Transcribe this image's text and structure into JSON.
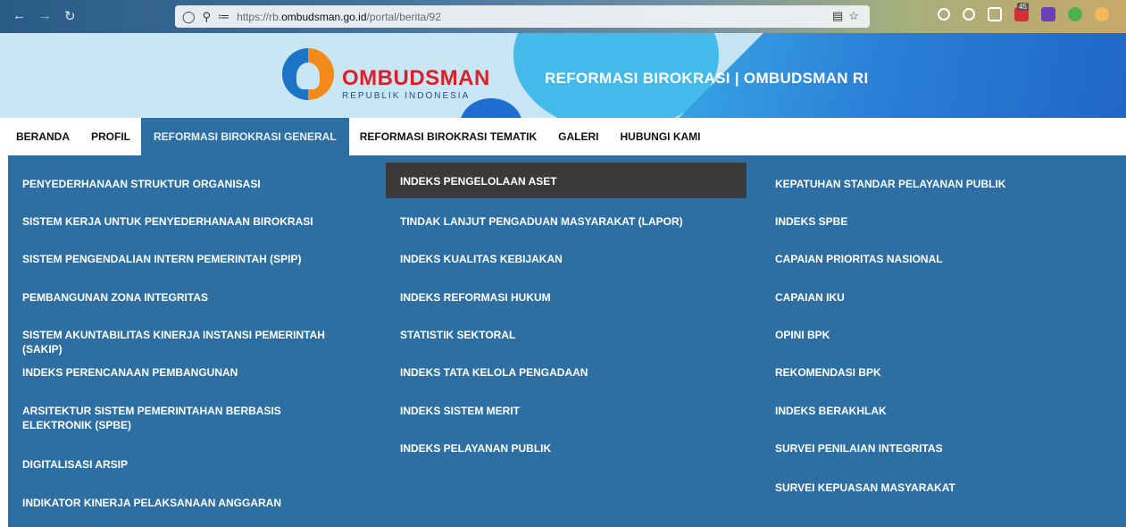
{
  "browser": {
    "back_icon": "arrow-left-icon",
    "forward_icon": "arrow-right-icon",
    "reload_icon": "reload-icon",
    "url_prefix": "https://rb.",
    "url_host": "ombudsman.go.id",
    "url_path": "/portal/berita/92",
    "extension_badge": "45"
  },
  "header": {
    "logo_title": "OMBUDSMAN",
    "logo_subtitle": "REPUBLIK INDONESIA",
    "site_title": "REFORMASI BIROKRASI | OMBUDSMAN RI"
  },
  "nav": {
    "items": [
      {
        "label": "BERANDA"
      },
      {
        "label": "PROFIL"
      },
      {
        "label": "REFORMASI BIROKRASI GENERAL"
      },
      {
        "label": "REFORMASI BIROKRASI TEMATIK"
      },
      {
        "label": "GALERI"
      },
      {
        "label": "HUBUNGI KAMI"
      }
    ],
    "active_index": 2
  },
  "menu": {
    "col1": [
      "PENYEDERHANAAN STRUKTUR ORGANISASI",
      "SISTEM KERJA UNTUK PENYEDERHANAAN BIROKRASI",
      "SISTEM PENGENDALIAN INTERN PEMERINTAH (SPIP)",
      "PEMBANGUNAN ZONA INTEGRITAS",
      "SISTEM AKUNTABILITAS KINERJA INSTANSI PEMERINTAH (SAKIP)",
      "INDEKS PERENCANAAN PEMBANGUNAN",
      "ARSITEKTUR SISTEM PEMERINTAHAN BERBASIS ELEKTRONIK (SPBE)",
      "DIGITALISASI ARSIP",
      "INDIKATOR KINERJA PELAKSANAAN ANGGARAN"
    ],
    "col2": [
      "INDEKS PENGELOLAAN ASET",
      "TINDAK LANJUT PENGADUAN MASYARAKAT (LAPOR)",
      "INDEKS KUALITAS KEBIJAKAN",
      "INDEKS REFORMASI HUKUM",
      "STATISTIK SEKTORAL",
      "INDEKS TATA KELOLA PENGADAAN",
      "INDEKS SISTEM MERIT",
      "INDEKS PELAYANAN PUBLIK"
    ],
    "col3": [
      "KEPATUHAN STANDAR PELAYANAN PUBLIK",
      "INDEKS SPBE",
      "CAPAIAN PRIORITAS NASIONAL",
      "CAPAIAN IKU",
      "OPINI BPK",
      "REKOMENDASI BPK",
      "INDEKS BERAKHLAK",
      "SURVEI PENILAIAN INTEGRITAS",
      "SURVEI KEPUASAN MASYARAKAT"
    ],
    "highlighted": "INDEKS PENGELOLAAN ASET"
  }
}
